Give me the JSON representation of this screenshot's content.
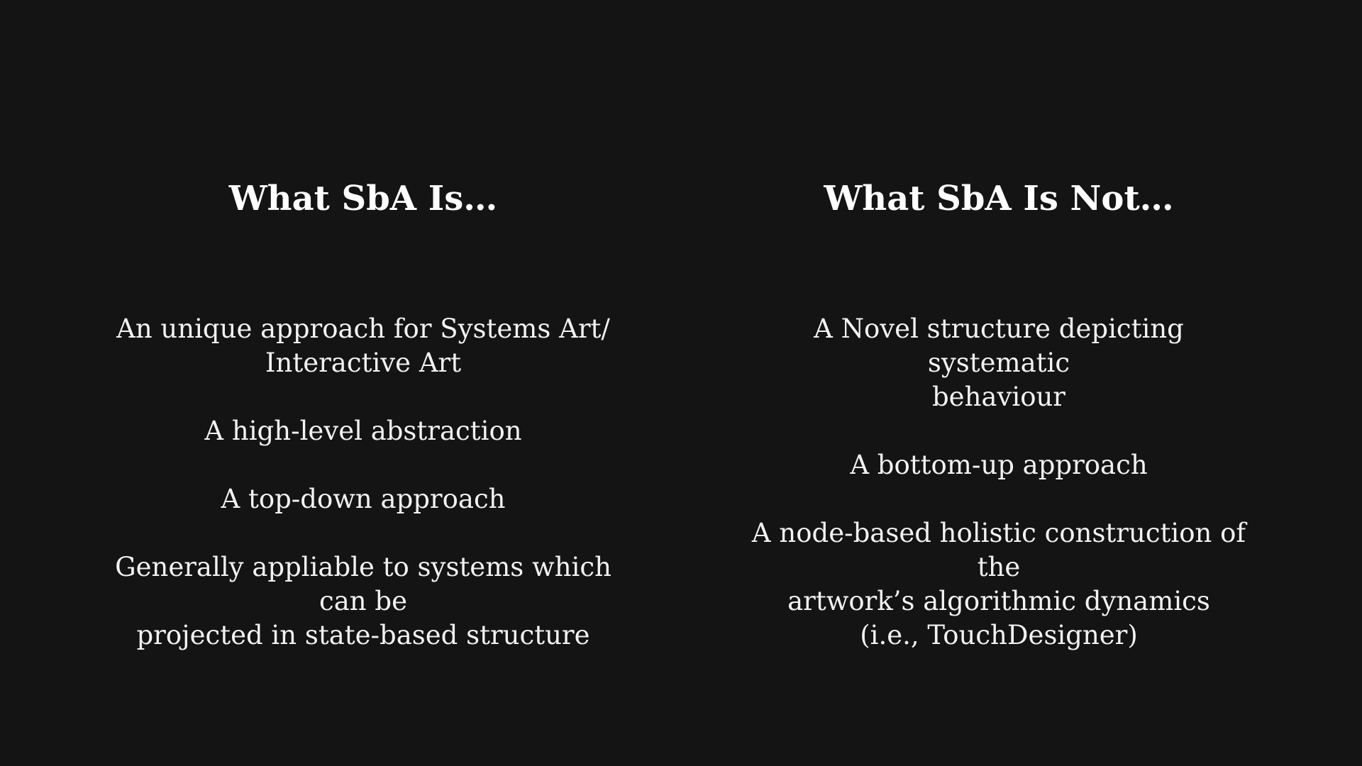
{
  "left": {
    "heading": "What SbA Is…",
    "items": [
      "An unique approach for Systems Art/\nInteractive Art",
      "A high-level abstraction",
      "A top-down approach",
      "Generally appliable to systems which can be\nprojected in state-based structure"
    ]
  },
  "right": {
    "heading": "What SbA Is Not…",
    "items": [
      "A Novel structure depicting systematic\nbehaviour",
      "A bottom-up approach",
      "A node-based holistic construction of the\nartwork’s algorithmic dynamics\n(i.e., TouchDesigner)"
    ]
  }
}
